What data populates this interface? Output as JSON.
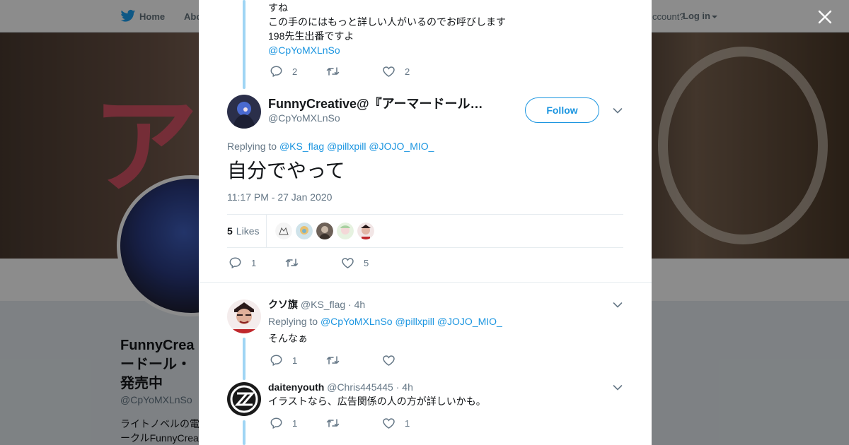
{
  "background": {
    "nav": {
      "home": "Home",
      "about": "Abo",
      "account_prompt": "ccount?",
      "login": "Log in"
    },
    "profile_name": "FunnyCreative@『アーマードール・アリス』発売中",
    "profile_name_lines": [
      "FunnyCrea",
      "ードール・",
      "発売中"
    ],
    "profile_handle": "@CpYoMXLnSo",
    "bio_lines": [
      "ライトノベルの電",
      "ークルFunnyCrea"
    ],
    "banner_text": "ア"
  },
  "modal": {
    "parent_tweet": {
      "lines": [
        "すね",
        "この手のにはもっと詳しい人がいるのでお呼びします",
        "198先生出番ですよ"
      ],
      "mention": "@CpYoMXLnSo",
      "reply_count": "2",
      "like_count": "2"
    },
    "focus_tweet": {
      "display_name": "FunnyCreative@『アーマードール…",
      "handle": "@CpYoMXLnSo",
      "follow_label": "Follow",
      "replying_to_label": "Replying to",
      "replying_to": [
        "@KS_flag",
        "@pillxpill",
        "@JOJO_MIO_"
      ],
      "text": "自分でやって",
      "timestamp": "11:17 PM - 27 Jan 2020",
      "likes_count": "5",
      "likes_label": "Likes",
      "reply_count": "1",
      "like_count": "5"
    },
    "replies": [
      {
        "display_name": "クソ旗",
        "handle": "@KS_flag",
        "time": "· 4h",
        "replying_to_label": "Replying to",
        "replying_to": [
          "@CpYoMXLnSo",
          "@pillxpill",
          "@JOJO_MIO_"
        ],
        "text": "そんなぁ",
        "reply_count": "1",
        "like_count": ""
      },
      {
        "display_name": "daitenyouth",
        "handle": "@Chris445445",
        "time": "· 4h",
        "text": "イラストなら、広告関係の人の方が詳しいかも。",
        "reply_count": "1",
        "like_count": "1"
      }
    ]
  },
  "colors": {
    "link": "#1b95e0",
    "muted": "#657786",
    "thread_line": "#9fd5f4",
    "text": "#14171a"
  },
  "icons": [
    "twitter-bird-icon",
    "close-icon",
    "reply-icon",
    "retweet-icon",
    "like-icon",
    "chevron-down-icon",
    "caret-down-icon"
  ]
}
